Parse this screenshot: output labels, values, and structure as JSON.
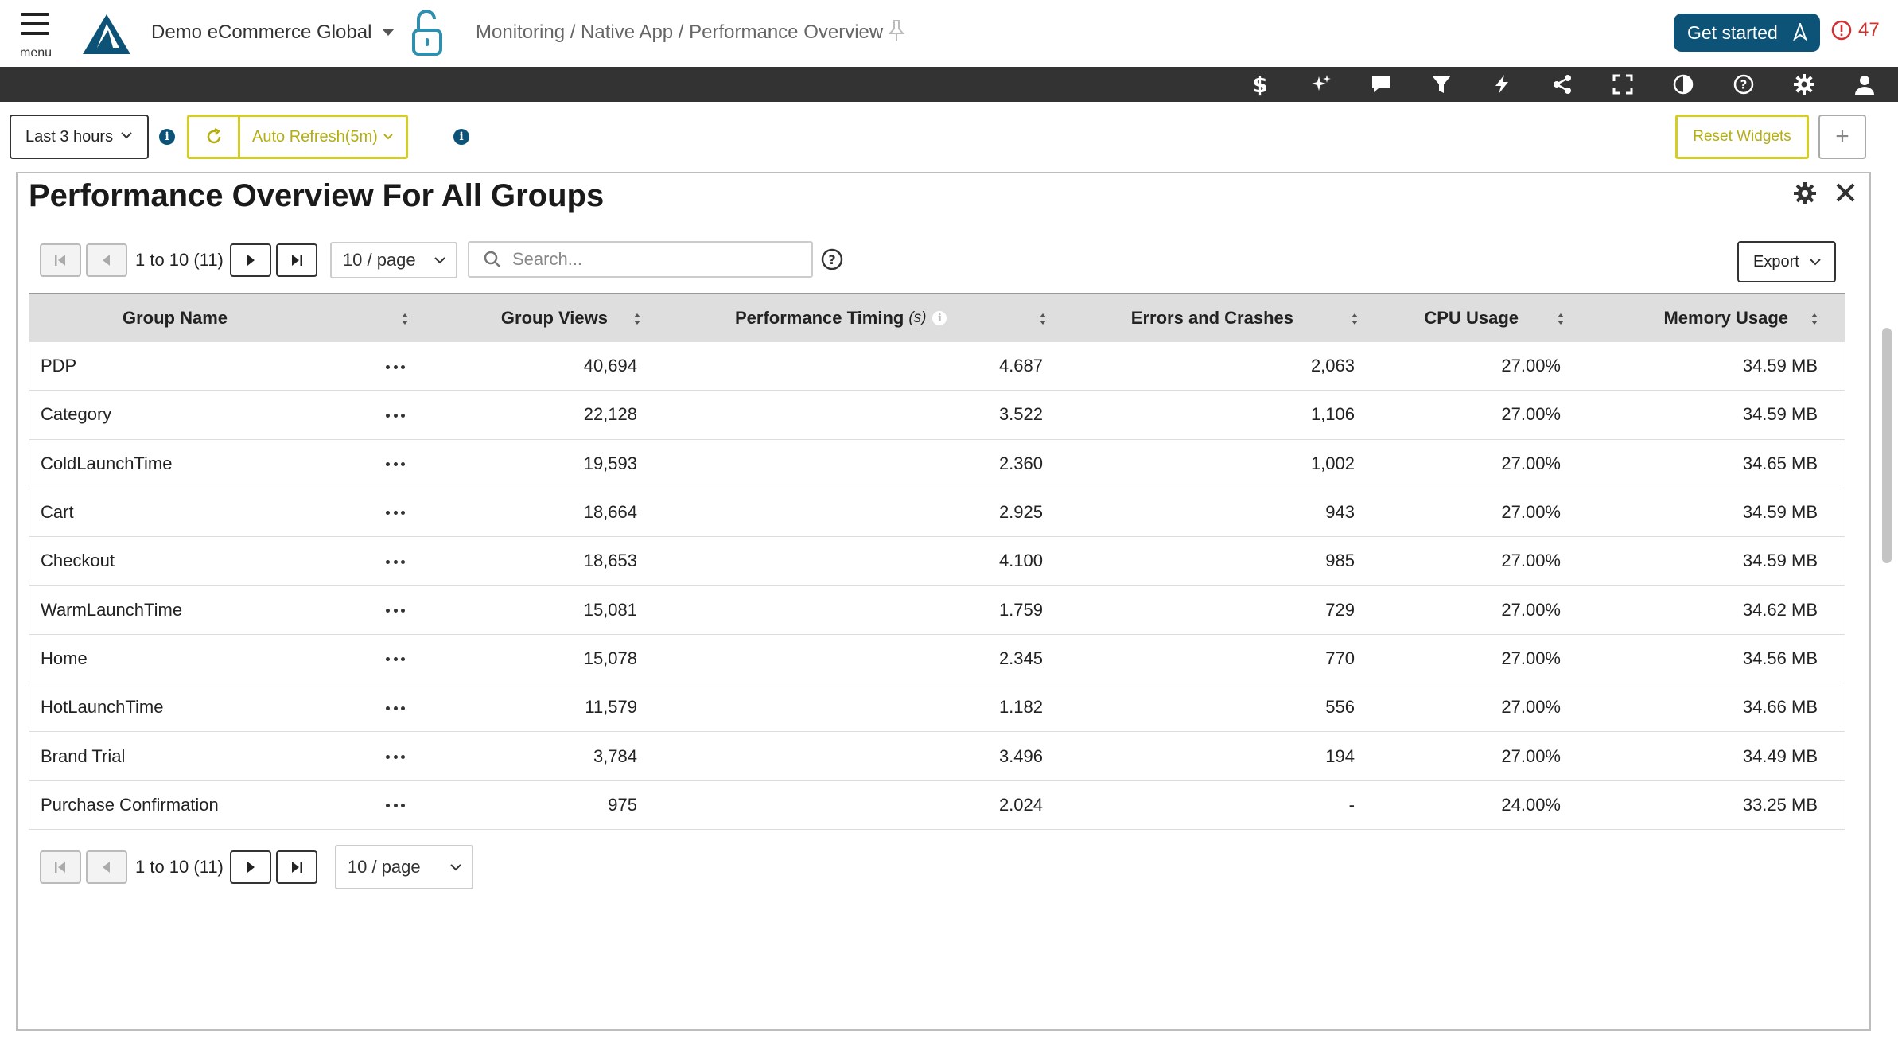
{
  "header": {
    "menu_label": "menu",
    "org_name": "Demo eCommerce Global",
    "breadcrumb": "Monitoring / Native App / Performance Overview",
    "get_started": "Get started",
    "alert_count": "47",
    "brand_color": "#0c5377"
  },
  "toolbar_icons": [
    "dollar-icon",
    "sparkles-icon",
    "chat-icon",
    "filter-icon",
    "lightning-icon",
    "share-icon",
    "fullscreen-icon",
    "contrast-icon",
    "help-icon",
    "gear-icon",
    "user-icon"
  ],
  "controls": {
    "time_range": "Last 3 hours",
    "auto_refresh": "Auto Refresh(5m)",
    "reset_widgets": "Reset Widgets",
    "add_symbol": "+",
    "accent_color": "#d4cd26"
  },
  "widget": {
    "title": "Performance Overview For All Groups",
    "pager_text": "1 to 10 (11)",
    "page_size": "10 / page",
    "search_placeholder": "Search...",
    "export_label": "Export"
  },
  "table": {
    "columns": [
      "Group Name",
      "Group Views",
      "Performance Timing",
      "Errors and Crashes",
      "CPU Usage",
      "Memory Usage"
    ],
    "timing_unit": "(s)",
    "rows": [
      [
        "PDP",
        "40,694",
        "4.687",
        "2,063",
        "27.00%",
        "34.59 MB"
      ],
      [
        "Category",
        "22,128",
        "3.522",
        "1,106",
        "27.00%",
        "34.59 MB"
      ],
      [
        "ColdLaunchTime",
        "19,593",
        "2.360",
        "1,002",
        "27.00%",
        "34.65 MB"
      ],
      [
        "Cart",
        "18,664",
        "2.925",
        "943",
        "27.00%",
        "34.59 MB"
      ],
      [
        "Checkout",
        "18,653",
        "4.100",
        "985",
        "27.00%",
        "34.59 MB"
      ],
      [
        "WarmLaunchTime",
        "15,081",
        "1.759",
        "729",
        "27.00%",
        "34.62 MB"
      ],
      [
        "Home",
        "15,078",
        "2.345",
        "770",
        "27.00%",
        "34.56 MB"
      ],
      [
        "HotLaunchTime",
        "11,579",
        "1.182",
        "556",
        "27.00%",
        "34.66 MB"
      ],
      [
        "Brand Trial",
        "3,784",
        "3.496",
        "194",
        "27.00%",
        "34.49 MB"
      ],
      [
        "Purchase Confirmation",
        "975",
        "2.024",
        "-",
        "24.00%",
        "33.25 MB"
      ]
    ]
  }
}
